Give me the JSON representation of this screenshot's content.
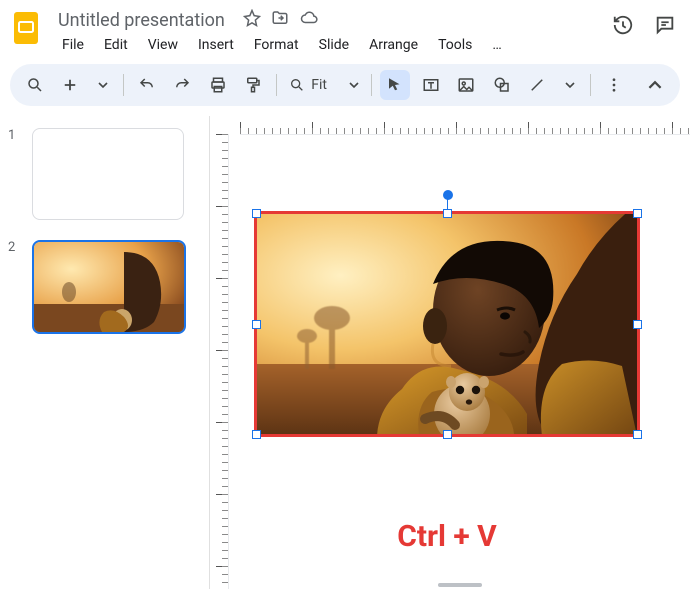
{
  "app": {
    "title": "Untitled presentation"
  },
  "menubar": {
    "items": [
      "File",
      "Edit",
      "View",
      "Insert",
      "Format",
      "Slide",
      "Arrange",
      "Tools"
    ],
    "overflow": "…"
  },
  "toolbar": {
    "zoom_label": "Fit"
  },
  "thumbnails": {
    "items": [
      {
        "num": "1",
        "active": false
      },
      {
        "num": "2",
        "active": true
      }
    ]
  },
  "annotation": {
    "text": "Ctrl + V"
  }
}
